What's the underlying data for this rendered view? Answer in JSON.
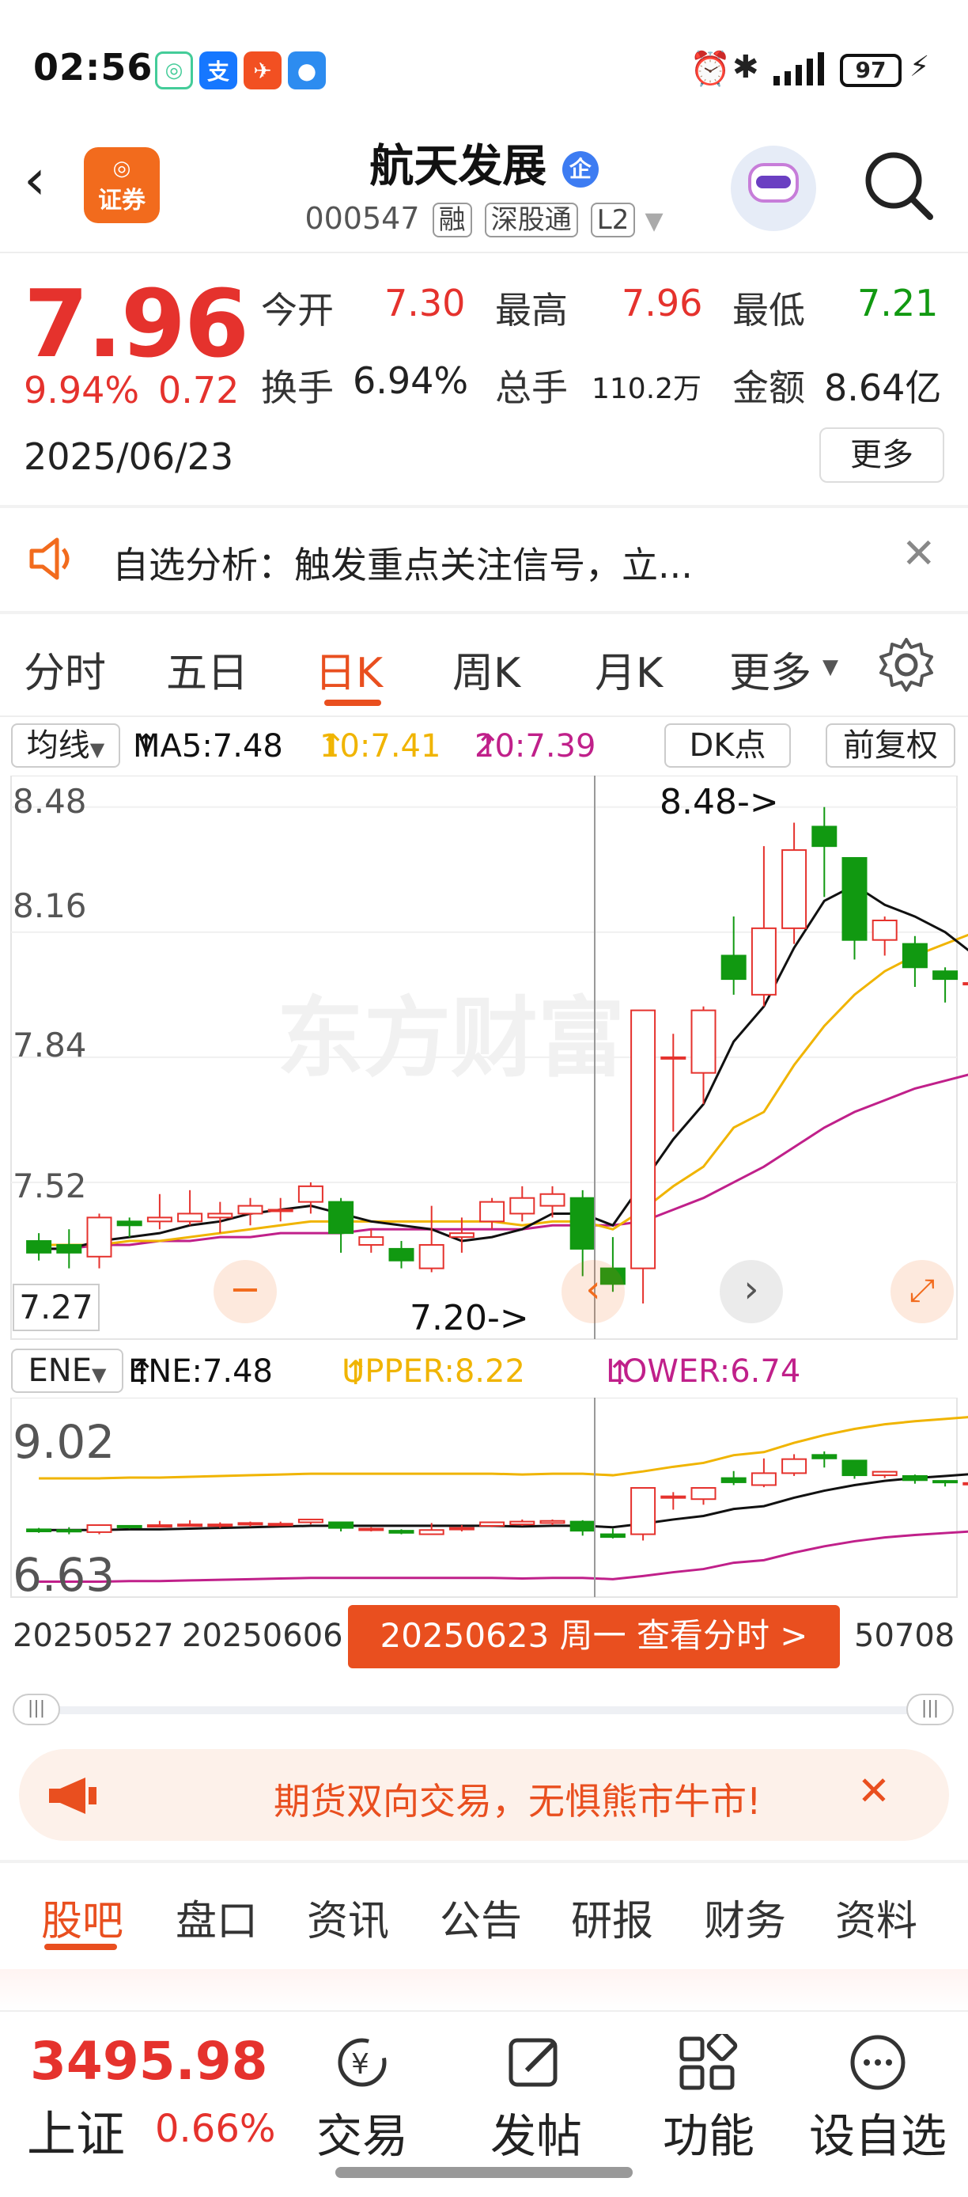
{
  "status_bar": {
    "time": "02:56",
    "battery": "97"
  },
  "header": {
    "title": "航天发展",
    "title_badge": "企",
    "code": "000547",
    "tags": [
      "融",
      "深股通",
      "L2"
    ],
    "broker_logo": "证券"
  },
  "quote": {
    "price": "7.96",
    "change_pct": "9.94%",
    "change": "0.72",
    "date": "2025/06/23",
    "open_label": "今开",
    "open": "7.30",
    "high_label": "最高",
    "high": "7.96",
    "low_label": "最低",
    "low": "7.21",
    "turnover_label": "换手",
    "turnover": "6.94%",
    "volume_label": "总手",
    "volume": "110.2万",
    "amount_label": "金额",
    "amount": "8.64亿",
    "more": "更多"
  },
  "notice": {
    "text": "自选分析：触发重点关注信号，立..."
  },
  "period_tabs": [
    "分时",
    "五日",
    "日K",
    "周K",
    "月K",
    "更多"
  ],
  "active_period": "日K",
  "ma_row": {
    "selector": "均线",
    "ma5": "MA5:7.48",
    "ma10": "10:7.41",
    "ma20": "20:7.39",
    "dk": "DK点",
    "adjust": "前复权"
  },
  "main_chart": {
    "y_labels": [
      "8.48",
      "8.16",
      "7.84",
      "7.52"
    ],
    "cursor_price": "7.27",
    "high_marker": "8.48->",
    "low_marker": "7.20->",
    "watermark": "东方财富"
  },
  "ene_row": {
    "selector": "ENE",
    "ene": "ENE:7.48",
    "upper": "UPPER:8.22",
    "lower": "LOWER:6.74",
    "y_top": "9.02",
    "y_bottom": "6.63"
  },
  "chart_data": {
    "type": "candlestick",
    "candles": [
      {
        "o": 7.37,
        "c": 7.34,
        "h": 7.39,
        "l": 7.32
      },
      {
        "o": 7.36,
        "c": 7.34,
        "h": 7.4,
        "l": 7.3
      },
      {
        "o": 7.33,
        "c": 7.43,
        "h": 7.44,
        "l": 7.3
      },
      {
        "o": 7.42,
        "c": 7.41,
        "h": 7.43,
        "l": 7.38
      },
      {
        "o": 7.42,
        "c": 7.43,
        "h": 7.49,
        "l": 7.4
      },
      {
        "o": 7.42,
        "c": 7.44,
        "h": 7.5,
        "l": 7.41
      },
      {
        "o": 7.43,
        "c": 7.44,
        "h": 7.47,
        "l": 7.39
      },
      {
        "o": 7.44,
        "c": 7.46,
        "h": 7.48,
        "l": 7.41
      },
      {
        "o": 7.45,
        "c": 7.45,
        "h": 7.48,
        "l": 7.42
      },
      {
        "o": 7.47,
        "c": 7.51,
        "h": 7.52,
        "l": 7.44
      },
      {
        "o": 7.47,
        "c": 7.39,
        "h": 7.48,
        "l": 7.34
      },
      {
        "o": 7.36,
        "c": 7.38,
        "h": 7.4,
        "l": 7.34
      },
      {
        "o": 7.35,
        "c": 7.32,
        "h": 7.37,
        "l": 7.3
      },
      {
        "o": 7.3,
        "c": 7.36,
        "h": 7.46,
        "l": 7.29
      },
      {
        "o": 7.38,
        "c": 7.39,
        "h": 7.43,
        "l": 7.34
      },
      {
        "o": 7.42,
        "c": 7.47,
        "h": 7.48,
        "l": 7.4
      },
      {
        "o": 7.44,
        "c": 7.48,
        "h": 7.51,
        "l": 7.42
      },
      {
        "o": 7.46,
        "c": 7.49,
        "h": 7.51,
        "l": 7.43
      },
      {
        "o": 7.48,
        "c": 7.35,
        "h": 7.5,
        "l": 7.28
      },
      {
        "o": 7.3,
        "c": 7.26,
        "h": 7.38,
        "l": 7.24
      },
      {
        "o": 7.3,
        "c": 7.96,
        "h": 7.96,
        "l": 7.21
      },
      {
        "o": 7.84,
        "c": 7.84,
        "h": 7.9,
        "l": 7.65
      },
      {
        "o": 7.8,
        "c": 7.96,
        "h": 7.97,
        "l": 7.72
      },
      {
        "o": 8.1,
        "c": 8.04,
        "h": 8.2,
        "l": 8.0
      },
      {
        "o": 8.0,
        "c": 8.17,
        "h": 8.38,
        "l": 7.97
      },
      {
        "o": 8.17,
        "c": 8.37,
        "h": 8.44,
        "l": 8.13
      },
      {
        "o": 8.43,
        "c": 8.38,
        "h": 8.48,
        "l": 8.25
      },
      {
        "o": 8.35,
        "c": 8.14,
        "h": 8.35,
        "l": 8.09
      },
      {
        "o": 8.14,
        "c": 8.19,
        "h": 8.2,
        "l": 8.1
      },
      {
        "o": 8.13,
        "c": 8.07,
        "h": 8.15,
        "l": 8.02
      },
      {
        "o": 8.06,
        "c": 8.04,
        "h": 8.07,
        "l": 7.98
      },
      {
        "o": 8.03,
        "c": 8.03,
        "h": 8.05,
        "l": 8.0
      }
    ],
    "ma5": [
      7.35,
      7.35,
      7.37,
      7.38,
      7.39,
      7.41,
      7.42,
      7.44,
      7.45,
      7.46,
      7.44,
      7.42,
      7.41,
      7.4,
      7.37,
      7.38,
      7.4,
      7.44,
      7.44,
      7.41,
      7.52,
      7.63,
      7.72,
      7.88,
      7.97,
      8.12,
      8.24,
      8.28,
      8.23,
      8.2,
      8.16,
      8.1
    ],
    "ma10": [
      7.36,
      7.36,
      7.36,
      7.37,
      7.37,
      7.38,
      7.39,
      7.4,
      7.41,
      7.42,
      7.42,
      7.42,
      7.42,
      7.42,
      7.42,
      7.42,
      7.41,
      7.42,
      7.42,
      7.4,
      7.45,
      7.51,
      7.56,
      7.66,
      7.7,
      7.82,
      7.92,
      8.0,
      8.06,
      8.1,
      8.13,
      8.16
    ],
    "ma20": [
      7.35,
      7.35,
      7.36,
      7.36,
      7.37,
      7.37,
      7.38,
      7.38,
      7.39,
      7.39,
      7.39,
      7.4,
      7.4,
      7.4,
      7.4,
      7.4,
      7.4,
      7.41,
      7.41,
      7.41,
      7.42,
      7.45,
      7.48,
      7.52,
      7.56,
      7.61,
      7.66,
      7.7,
      7.73,
      7.76,
      7.78,
      7.8
    ],
    "ylim": [
      7.2,
      8.52
    ]
  },
  "x_axis": {
    "labels": [
      "20250527",
      "20250606",
      "50708"
    ],
    "cursor_label": "20250623 周一 查看分时 >"
  },
  "promo": {
    "text": "期货双向交易，无惧熊市牛市!"
  },
  "bottom_tabs": [
    "股吧",
    "盘口",
    "资讯",
    "公告",
    "研报",
    "财务",
    "资料"
  ],
  "bottom_bar": {
    "index_value": "3495.98",
    "index_name": "上证",
    "index_change": "0.66%",
    "items": [
      "交易",
      "发帖",
      "功能",
      "设自选"
    ]
  },
  "colors": {
    "up": "#e5322d",
    "down": "#119911",
    "accent": "#e94f1f",
    "ma10": "#f0b400",
    "ma20": "#c0208a"
  }
}
